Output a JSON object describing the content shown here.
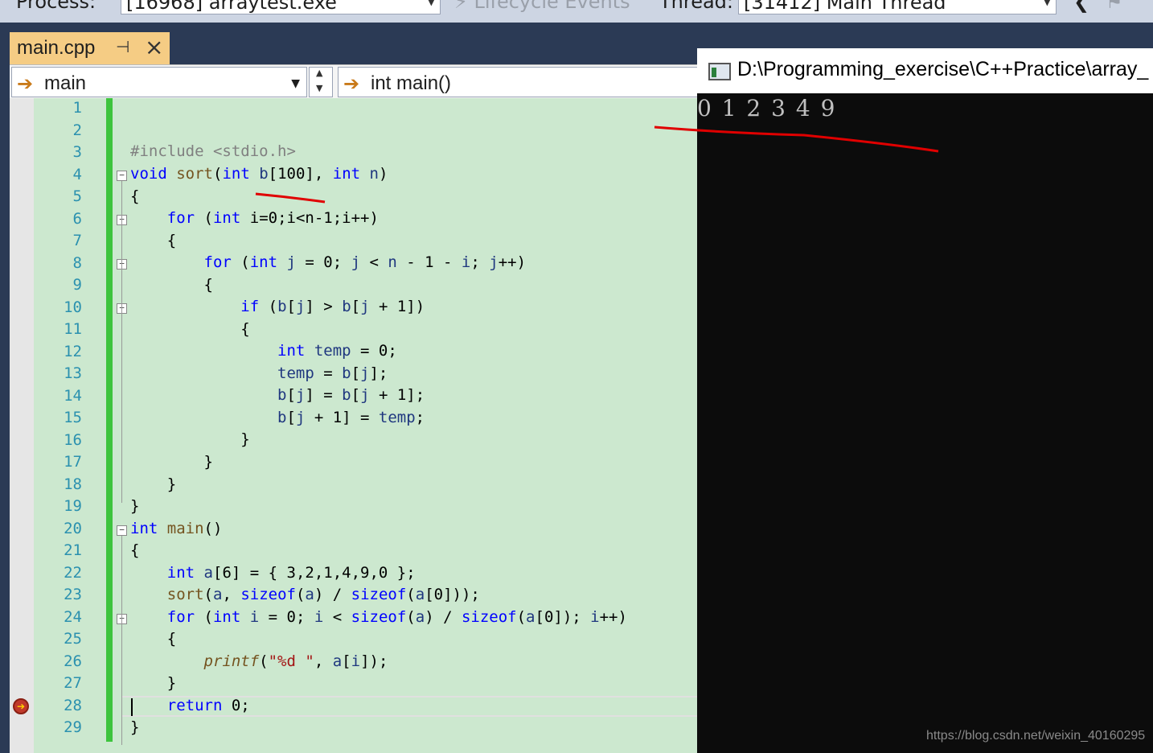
{
  "toolbar": {
    "process_label": "Process:",
    "process_value": "[16968] arraytest.exe",
    "lifecycle_label": "Lifecycle Events",
    "thread_label": "Thread:",
    "thread_value": "[31412] Main Thread"
  },
  "editor": {
    "tab_title": "main.cpp",
    "scope_combo": "main",
    "member_combo": "int main()",
    "line_numbers": [
      "1",
      "2",
      "3",
      "4",
      "5",
      "6",
      "7",
      "8",
      "9",
      "10",
      "11",
      "12",
      "13",
      "14",
      "15",
      "16",
      "17",
      "18",
      "19",
      "20",
      "21",
      "22",
      "23",
      "24",
      "25",
      "26",
      "27",
      "28",
      "29"
    ],
    "current_line": 28
  },
  "console": {
    "title": "D:\\Programming_exercise\\C++Practice\\array_",
    "output": "0 1 2 3 4 9"
  },
  "watermark": "https://blog.csdn.net/weixin_40160295",
  "colors": {
    "editor_bg": "#cce8cf",
    "tab_active": "#f5cc84",
    "change_bar": "#3dc43d",
    "annotation_red": "#e00000"
  }
}
